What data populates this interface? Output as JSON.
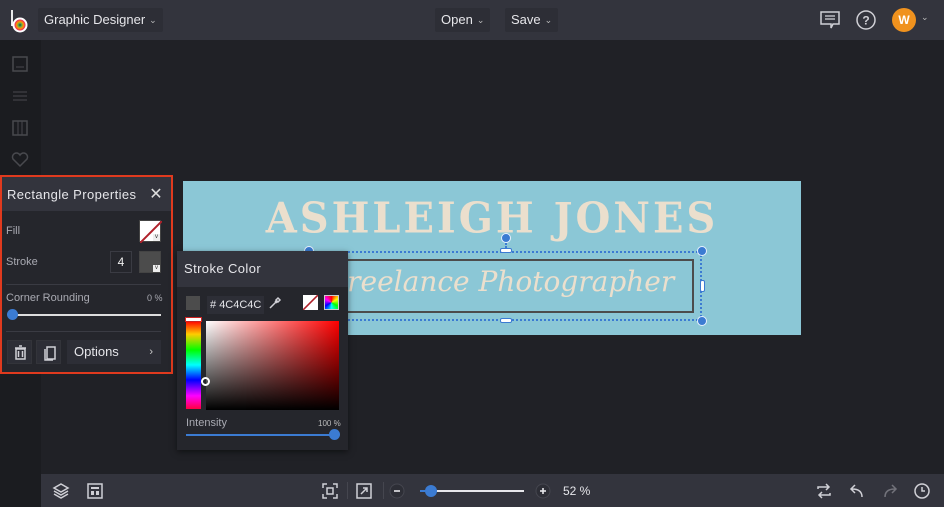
{
  "topbar": {
    "app_logo": "befunky-logo-icon",
    "mode_label": "Graphic Designer",
    "open_label": "Open",
    "save_label": "Save",
    "avatar_initial": "W",
    "icons": [
      "comment-icon",
      "help-icon",
      "chevron-down-icon"
    ]
  },
  "left_rail": {
    "icons": [
      "image-icon",
      "sliders-icon",
      "layout-icon",
      "heart-icon"
    ]
  },
  "canvas": {
    "background_color": "#8BC7D6",
    "title_text": "ASHLEIGH JONES",
    "subtitle_text": "Freelance Photographer",
    "text_color": "#EBDFCD",
    "selection_color": "#3B7BD2"
  },
  "properties_panel": {
    "title": "Rectangle Properties",
    "fill_label": "Fill",
    "fill_value": "none",
    "stroke_label": "Stroke",
    "stroke_width": "4",
    "stroke_color": "#4C4C4C",
    "corner_rounding_label": "Corner Rounding",
    "corner_rounding_value": "0 %",
    "corner_rounding_fraction": 0,
    "options_label": "Options",
    "options_arrow": "›",
    "highlight_color": "#E03A1E"
  },
  "stroke_color_panel": {
    "title": "Stroke Color",
    "hex_prefix": "#",
    "hex_value": "4C4C4C",
    "intensity_label": "Intensity",
    "intensity_value": "100 %",
    "intensity_fraction": 1.0,
    "hue": "red"
  },
  "bottombar": {
    "zoom_value": "52 %",
    "zoom_fraction": 0.05,
    "zoom_minus": "−",
    "zoom_plus": "+"
  }
}
